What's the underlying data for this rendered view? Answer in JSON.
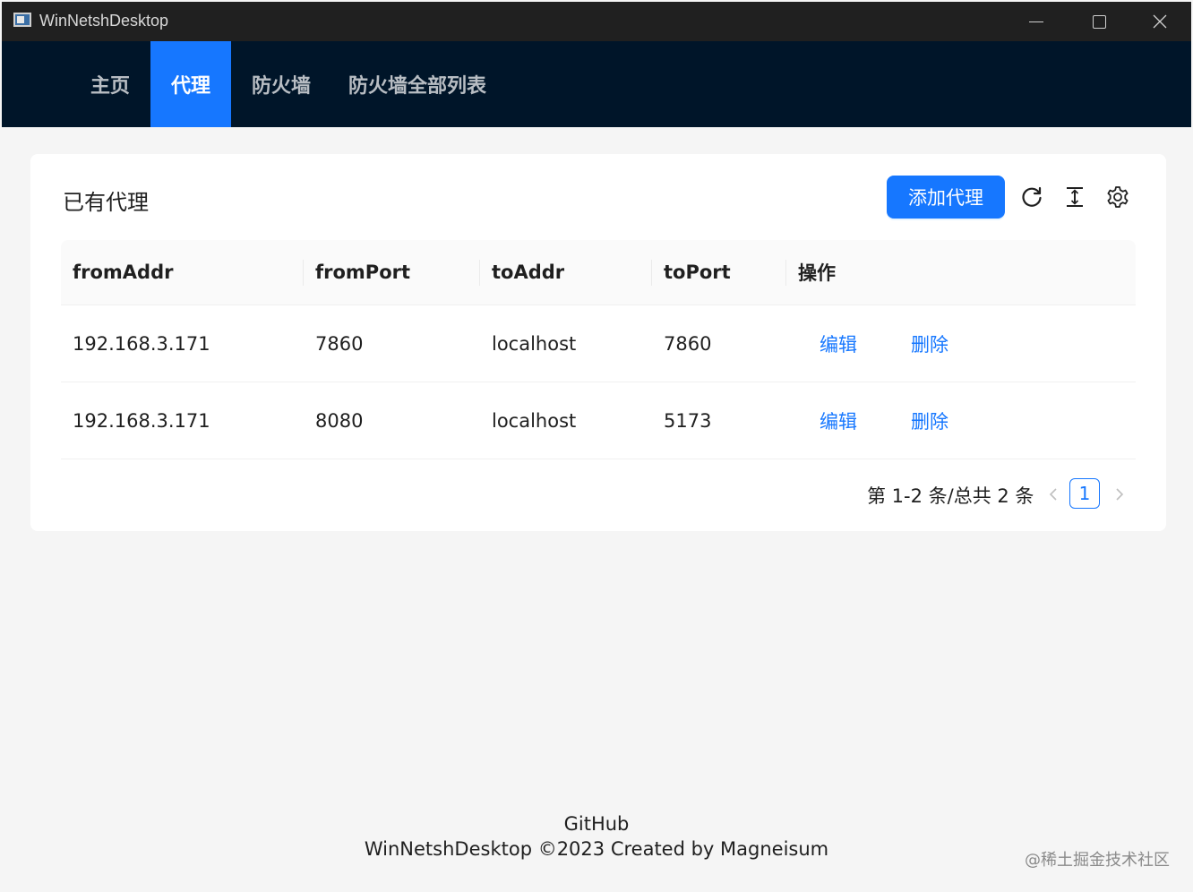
{
  "window": {
    "title": "WinNetshDesktop"
  },
  "nav": {
    "items": [
      {
        "label": "主页",
        "active": false
      },
      {
        "label": "代理",
        "active": true
      },
      {
        "label": "防火墙",
        "active": false
      },
      {
        "label": "防火墙全部列表",
        "active": false
      }
    ]
  },
  "card": {
    "title": "已有代理",
    "add_button": "添加代理",
    "tools": [
      "reload-icon",
      "column-height-icon",
      "setting-icon"
    ]
  },
  "table": {
    "columns": [
      "fromAddr",
      "fromPort",
      "toAddr",
      "toPort",
      "操作"
    ],
    "rows": [
      {
        "fromAddr": "192.168.3.171",
        "fromPort": "7860",
        "toAddr": "localhost",
        "toPort": "7860",
        "edit": "编辑",
        "delete": "删除"
      },
      {
        "fromAddr": "192.168.3.171",
        "fromPort": "8080",
        "toAddr": "localhost",
        "toPort": "5173",
        "edit": "编辑",
        "delete": "删除"
      }
    ]
  },
  "pagination": {
    "summary": "第 1-2 条/总共 2 条",
    "current_page": "1"
  },
  "footer": {
    "link": "GitHub",
    "copyright": "WinNetshDesktop ©2023 Created by Magneisum"
  },
  "watermark": "@稀土掘金技术社区",
  "colors": {
    "primary": "#1677ff",
    "nav_bg": "#001529",
    "titlebar_bg": "#202020"
  }
}
